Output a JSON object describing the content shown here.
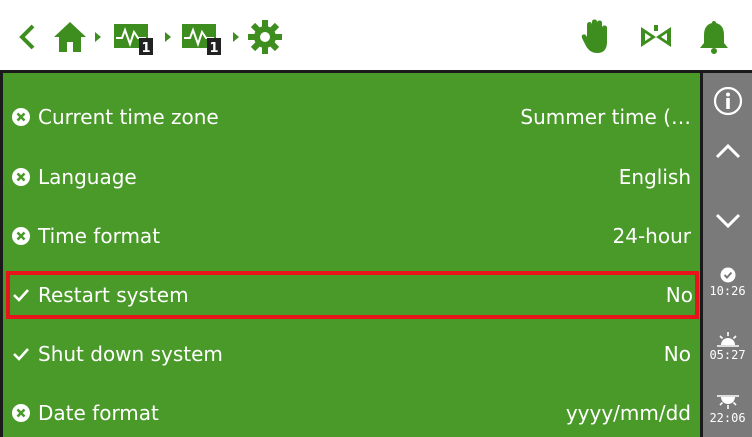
{
  "colors": {
    "accent_green": "#4a9a2a",
    "alert_red": "#e8141b",
    "sidebar_gray": "#7a7a7a"
  },
  "breadcrumb": {
    "items": [
      {
        "icon": "home-icon"
      },
      {
        "icon": "heating-circuit-icon",
        "badge": "1"
      },
      {
        "icon": "heating-circuit-icon",
        "badge": "1"
      },
      {
        "icon": "gear-icon"
      }
    ]
  },
  "header_icons": [
    "hand-icon",
    "valve-icon",
    "bell-icon"
  ],
  "settings": {
    "rows": [
      {
        "status": "error",
        "label": "Current time zone",
        "value": "Summer time (…"
      },
      {
        "status": "error",
        "label": "Language",
        "value": "English"
      },
      {
        "status": "error",
        "label": "Time format",
        "value": "24-hour"
      },
      {
        "status": "ok",
        "label": "Restart system",
        "value": "No"
      },
      {
        "status": "ok",
        "label": "Shut down system",
        "value": "No"
      },
      {
        "status": "error",
        "label": "Date format",
        "value": "yyyy/mm/dd"
      }
    ]
  },
  "sidebar": {
    "clock_time": "10:26",
    "sunrise_time": "05:27",
    "sunset_time": "22:06"
  }
}
